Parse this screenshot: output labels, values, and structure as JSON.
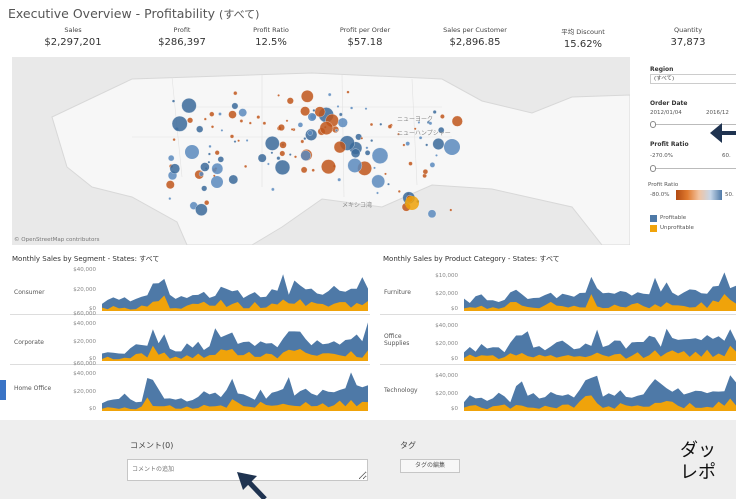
{
  "header": {
    "title": "Executive Overview - Profitability",
    "title_suffix": "(すべて)"
  },
  "kpis": [
    {
      "label": "Sales",
      "value": "$2,297,201"
    },
    {
      "label": "Profit",
      "value": "$286,397"
    },
    {
      "label": "Profit Ratio",
      "value": "12.5%"
    },
    {
      "label": "Profit per Order",
      "value": "$57.18"
    },
    {
      "label": "Sales per Customer",
      "value": "$2,896.85"
    },
    {
      "label": "平均 Discount",
      "value": "15.62%"
    },
    {
      "label": "Quantity",
      "value": "37,873"
    }
  ],
  "map": {
    "credit": "© OpenStreetMap contributors",
    "label_1": "ニューヨーク",
    "label_2": "ニューハンプシャー",
    "label_3": "メキシコ湾"
  },
  "filters": {
    "region_label": "Region",
    "region_value": "(すべて)",
    "order_date_label": "Order Date",
    "order_date_start": "2012/01/04",
    "order_date_end": "2016/12",
    "profit_ratio_label": "Profit Ratio",
    "profit_ratio_min": "-270.0%",
    "profit_ratio_max": "60.",
    "legend_title": "Profit Ratio",
    "legend_min": "-80.0%",
    "legend_max": "50.",
    "legend_profitable": "Profitable",
    "legend_unprofitable": "Unprofitable"
  },
  "charts": {
    "segment_title": "Monthly Sales by Segment - States: すべて",
    "category_title": "Monthly Sales by Product Category - States: すべて",
    "segment_rows": [
      "Consumer",
      "Corporate",
      "Home Office"
    ],
    "category_rows": [
      "Furniture",
      "Office Supplies",
      "Technology"
    ],
    "segment_ticks": [
      "$60,000",
      "$40,000",
      "$20,000",
      "$0"
    ],
    "category_ticks": [
      "$40,000",
      "$20,000",
      "$0"
    ],
    "category_ticks_first": [
      "$10,000",
      "$20,000",
      "$0"
    ]
  },
  "chart_data": {
    "type": "area",
    "title": "Monthly Sales by Segment - States: すべて",
    "colors": {
      "sales": "#4e79a7",
      "profit": "#f0a30a"
    }
  },
  "comments": {
    "label": "コメント(0)",
    "placeholder": "コメントの追加"
  },
  "tags": {
    "label": "タグ",
    "button": "タグの編集"
  },
  "overlay": {
    "line1": "ダッ",
    "line2": "レポ"
  }
}
